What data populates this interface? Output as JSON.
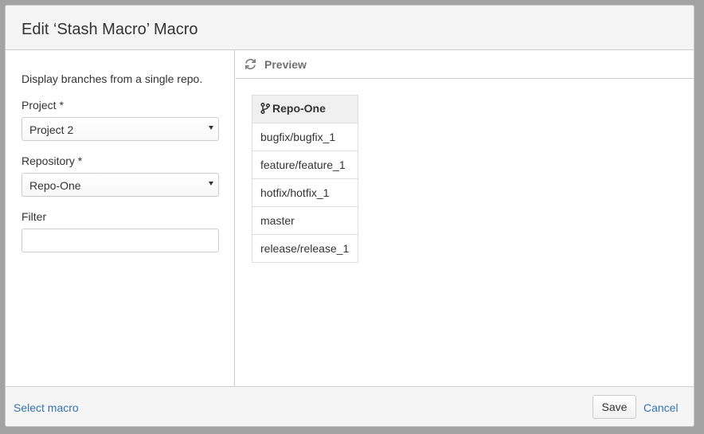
{
  "dialog": {
    "title": "Edit ‘Stash Macro’ Macro"
  },
  "form": {
    "description": "Display branches from a single repo.",
    "project": {
      "label": "Project *",
      "value": "Project 2"
    },
    "repository": {
      "label": "Repository *",
      "value": "Repo-One"
    },
    "filter": {
      "label": "Filter",
      "value": ""
    }
  },
  "preview": {
    "label": "Preview",
    "table": {
      "header": "Repo-One",
      "rows": [
        "bugfix/bugfix_1",
        "feature/feature_1",
        "hotfix/hotfix_1",
        "master",
        "release/release_1"
      ]
    }
  },
  "footer": {
    "select_macro": "Select macro",
    "save": "Save",
    "cancel": "Cancel"
  },
  "icons": {
    "refresh": "refresh-icon",
    "branch": "branch-icon",
    "dropdown": "chevron-down-icon"
  },
  "colors": {
    "link": "#3572b0",
    "overlay": "#a3a3a3",
    "header_bg": "#f5f5f5"
  }
}
